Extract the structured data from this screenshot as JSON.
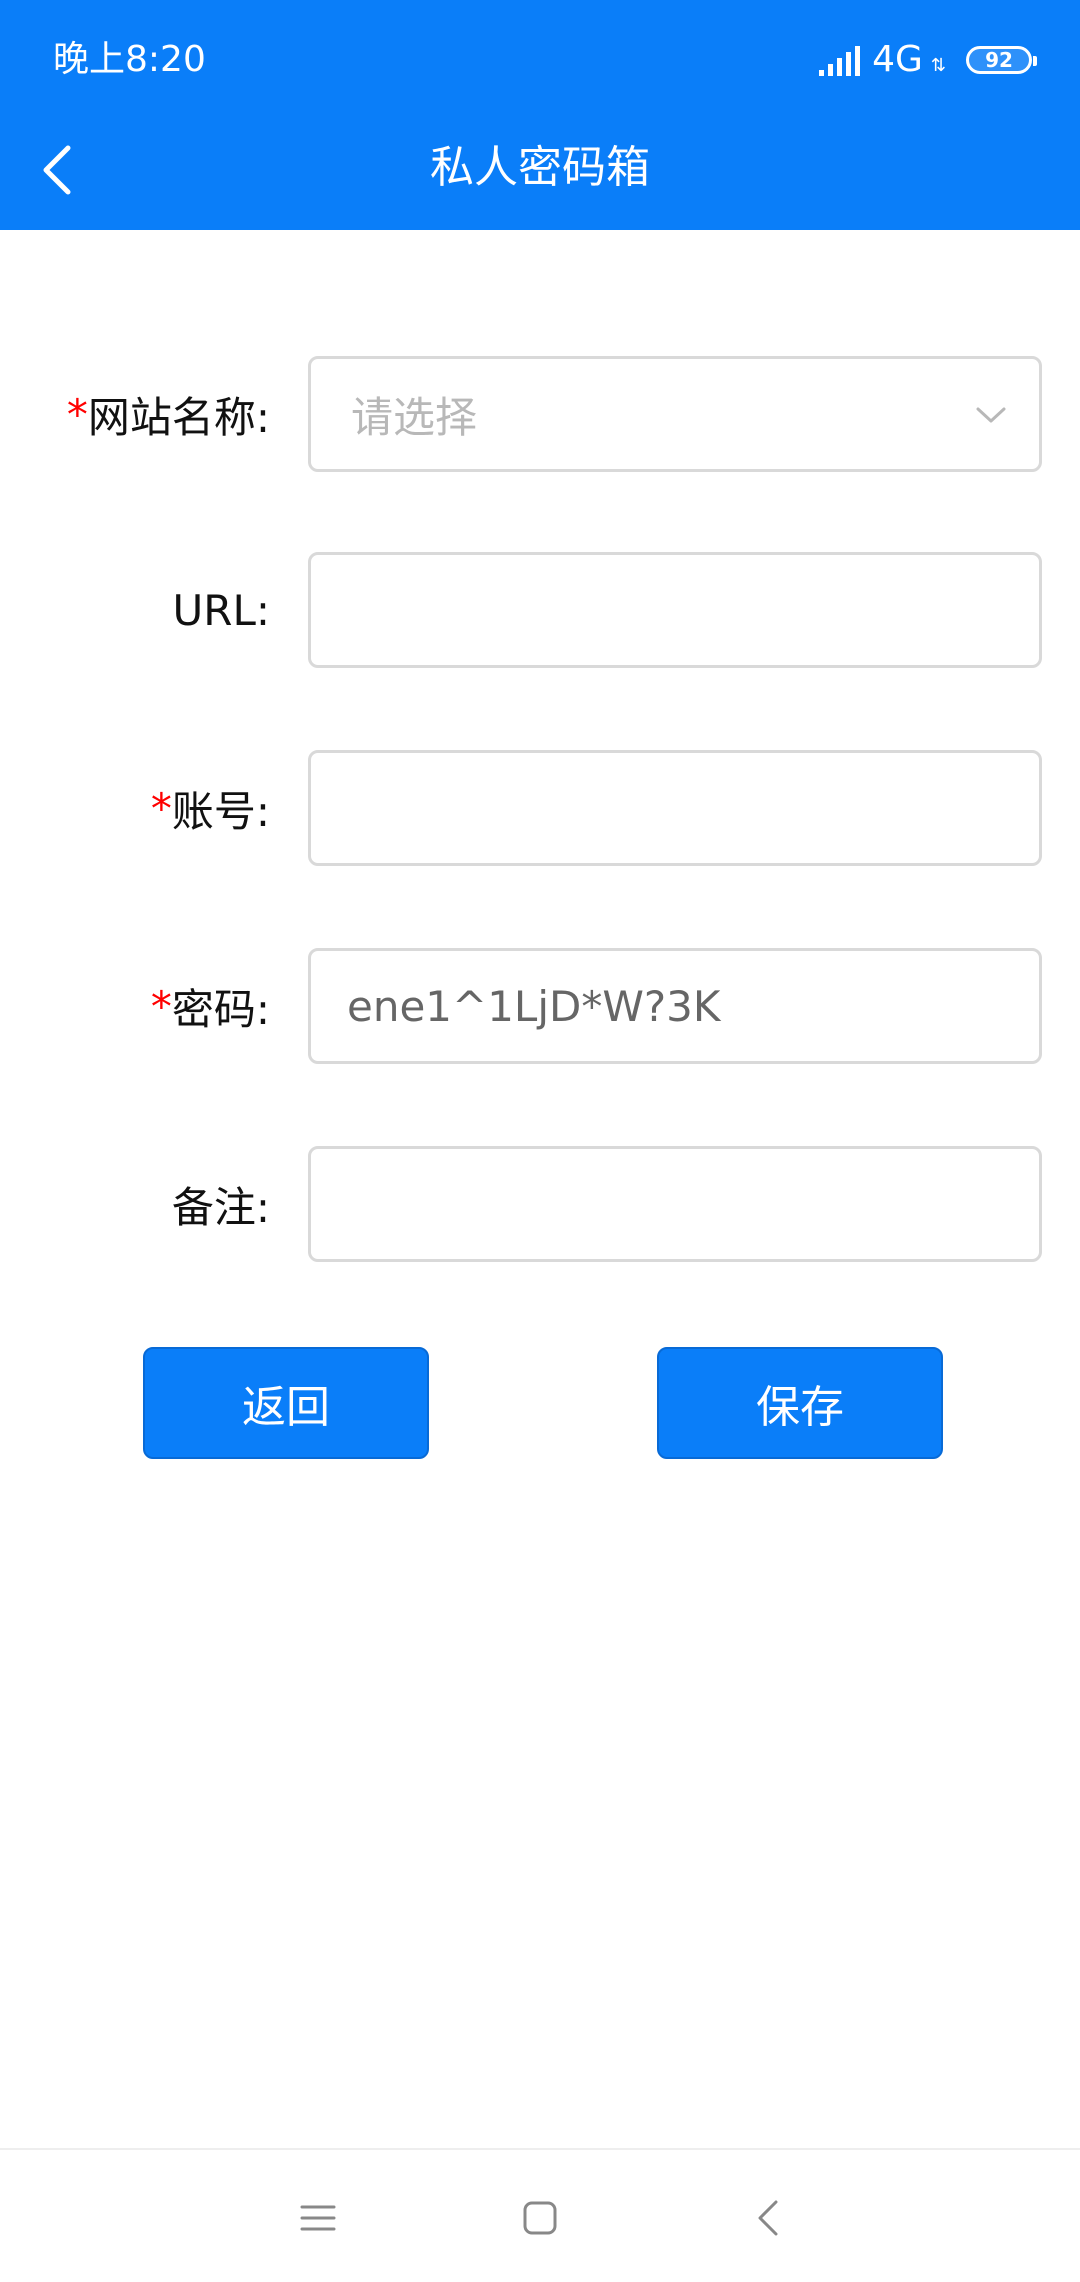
{
  "status_bar": {
    "time": "晚上8:20",
    "network": "4G",
    "battery": "92"
  },
  "app_bar": {
    "title": "私人密码箱"
  },
  "form": {
    "site_name": {
      "required_mark": "*",
      "label": "网站名称:",
      "placeholder": "请选择"
    },
    "url": {
      "label": "URL:",
      "value": ""
    },
    "account": {
      "required_mark": "*",
      "label": "账号:",
      "value": ""
    },
    "password": {
      "required_mark": "*",
      "label": "密码:",
      "value": "ene1^1LjD*W?3K"
    },
    "note": {
      "label": "备注:",
      "value": ""
    }
  },
  "buttons": {
    "back_label": "返回",
    "save_label": "保存"
  },
  "colors": {
    "primary": "#0A7EF9",
    "required": "#FF0000",
    "border": "#D9D9D9"
  }
}
